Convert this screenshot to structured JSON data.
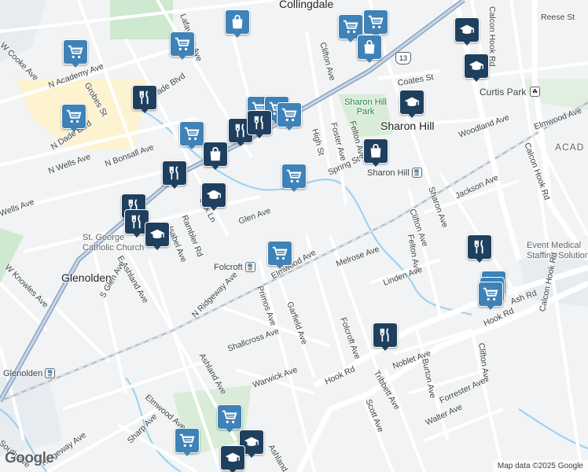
{
  "map": {
    "attribution": "Map data ©2025 Google",
    "logo": "Google",
    "route_shield": "13",
    "towns": [
      "Collingdale",
      "Sharon Hill",
      "Glenolden",
      "Folcroft"
    ],
    "parks": [
      "Sharon Hill Park",
      "Curtis Park"
    ],
    "stations": [
      "Sharon Hill",
      "Folcroft",
      "Glenolden"
    ],
    "pois": [
      "St. George Catholic Church",
      "Event Medical Staffing Solutions",
      "ACAD"
    ],
    "streets": [
      "N Dade Blvd",
      "Dade Blvd",
      "N Academy Ave",
      "Grobes St",
      "N Wells Ave",
      "N Bonsall Ave",
      "Wells Ave",
      "W Cooke Ave",
      "Lafayette Ave",
      "Clifton Ave",
      "Coates St",
      "High St",
      "Foster Ave",
      "Felton Ave",
      "Spring St",
      "Woodland Ave",
      "Elmwood Ave",
      "Calcon Hook Rd",
      "Reese St",
      "Jackson Ave",
      "Sharon Ave",
      "Linden Ave",
      "Melrose Ave",
      "Glen Ave",
      "Oak Ln",
      "Rambler Rd",
      "E Ashland Ave",
      "S Glen Ave",
      "W Knowles Ave",
      "N Ridgeway Ave",
      "Primos Ave",
      "Garfield Ave",
      "Shallcross Ave",
      "Ashland Ave",
      "Warwick Ave",
      "Hook Rd",
      "Folcroft Ave",
      "Tribbett Ave",
      "Noblet Ave",
      "Burton Ave",
      "Scott Ave",
      "Forrester Ave",
      "Walter Ave",
      "Ash Rd",
      "Sharp Ave",
      "Ridgeway Ave",
      "South Ave",
      "Elmwood Ave",
      "Isabel Ave"
    ],
    "markers": [
      {
        "type": "shopping-bag",
        "label": "shopping"
      },
      {
        "type": "grocery-cart",
        "label": "grocery"
      },
      {
        "type": "restaurant",
        "label": "restaurant"
      },
      {
        "type": "school",
        "label": "school"
      }
    ]
  }
}
